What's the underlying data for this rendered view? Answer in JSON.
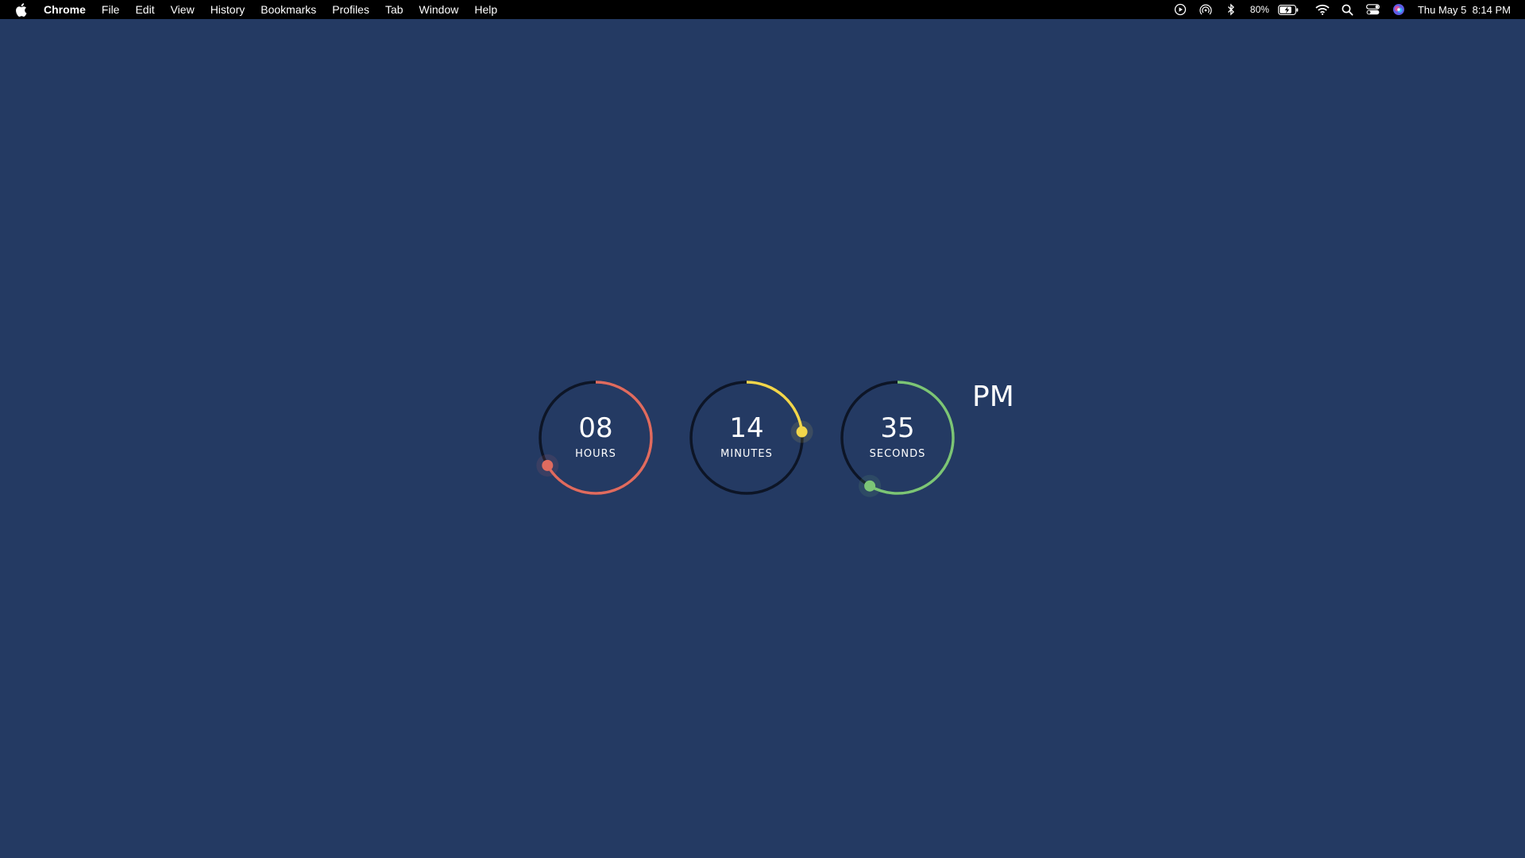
{
  "menubar": {
    "app_name": "Chrome",
    "menus": [
      "File",
      "Edit",
      "View",
      "History",
      "Bookmarks",
      "Profiles",
      "Tab",
      "Window",
      "Help"
    ],
    "battery_percent": "80%",
    "datetime": "Thu May 5  8:14 PM",
    "status_icons": [
      "play-circle-icon",
      "airdrop-icon",
      "bluetooth-icon",
      "battery-icon",
      "wifi-icon",
      "search-icon",
      "control-center-icon",
      "siri-icon"
    ]
  },
  "clock": {
    "hours": {
      "value": "08",
      "label": "HOURS",
      "fraction": 0.667,
      "color": "#e06b5f"
    },
    "minutes": {
      "value": "14",
      "label": "MINUTES",
      "fraction": 0.233,
      "color": "#f2d64b"
    },
    "seconds": {
      "value": "35",
      "label": "SECONDS",
      "fraction": 0.583,
      "color": "#7cc576"
    },
    "period": "PM",
    "track_color": "#0d1526"
  }
}
